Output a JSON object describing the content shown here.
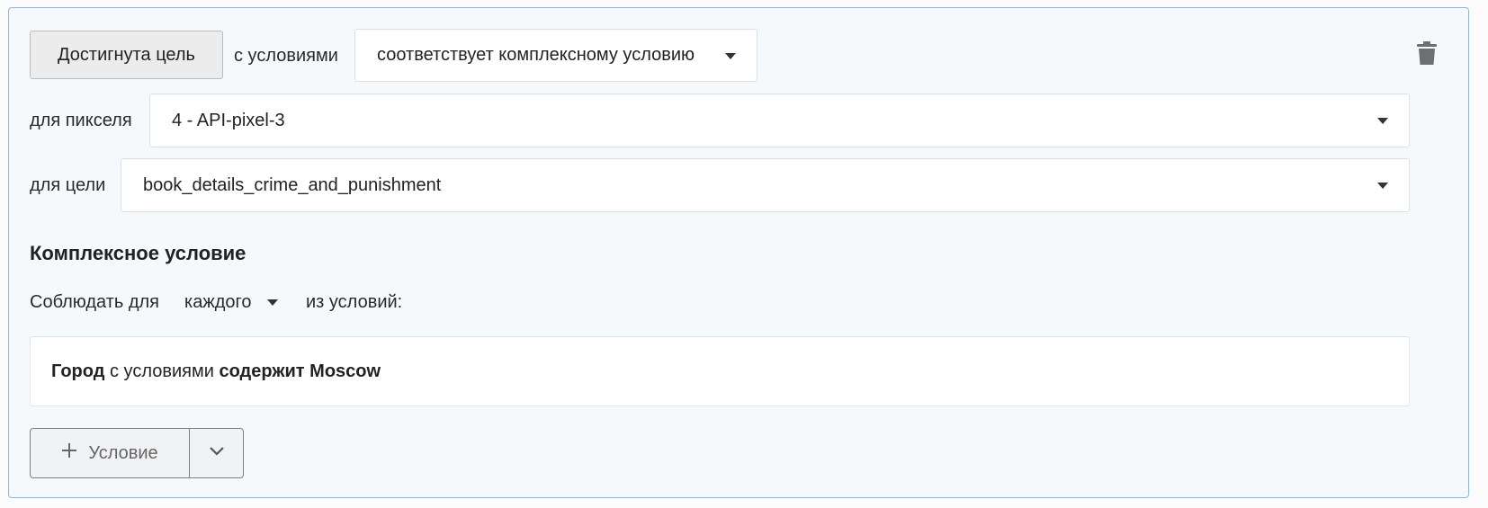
{
  "rule": {
    "goal_button_label": "Достигнута цель",
    "with_conditions_label": "с условиями",
    "condition_type_select": "соответствует комплексному условию",
    "pixel_label": "для пикселя",
    "pixel_select": "4 - API-pixel-3",
    "goal_label": "для цели",
    "goal_select": "book_details_crime_and_punishment",
    "delete_icon": "trash-icon"
  },
  "complex": {
    "heading": "Комплексное условие",
    "observe_label": "Соблюдать для",
    "quantifier_select": "каждого",
    "of_conditions_label": "из условий:",
    "conditions": [
      {
        "field": "Город",
        "connector": "с условиями",
        "operator": "содержит",
        "value": "Moscow"
      }
    ],
    "add_condition_label": "Условие",
    "add_icon": "plus-icon",
    "more_icon": "chevron-down-icon"
  },
  "colors": {
    "card_border": "#8db6e2",
    "card_background": "#f5f9fc"
  }
}
